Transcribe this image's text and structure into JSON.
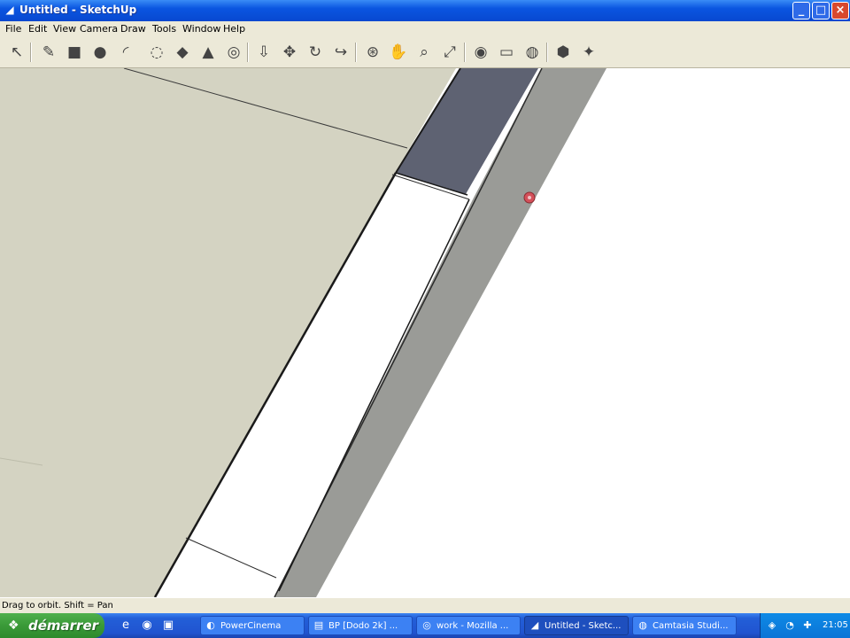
{
  "window": {
    "title": "Untitled - SketchUp",
    "app_icon": "sketchup-icon",
    "controls": {
      "minimize": "_",
      "maximize": "□",
      "close": "×"
    }
  },
  "menu": [
    "File",
    "Edit",
    "View",
    "Camera",
    "Draw",
    "Tools",
    "Window",
    "Help"
  ],
  "toolbar": {
    "tools": [
      {
        "name": "select-arrow-icon",
        "glyph": "↖"
      },
      {
        "name": "pencil-line-icon",
        "glyph": "✎"
      },
      {
        "name": "rectangle-icon",
        "glyph": "■"
      },
      {
        "name": "circle-icon",
        "glyph": "●"
      },
      {
        "name": "arc-icon",
        "glyph": "◜"
      },
      {
        "name": "offset-icon",
        "glyph": "◌"
      },
      {
        "name": "eraser-icon",
        "glyph": "◆"
      },
      {
        "name": "tape-measure-icon",
        "glyph": "▲"
      },
      {
        "name": "paint-bucket-icon",
        "glyph": "◎"
      },
      {
        "name": "push-pull-icon",
        "glyph": "⇩"
      },
      {
        "name": "move-icon",
        "glyph": "✥"
      },
      {
        "name": "rotate-icon",
        "glyph": "↻"
      },
      {
        "name": "follow-me-icon",
        "glyph": "↪"
      },
      {
        "name": "orbit-icon",
        "glyph": "⊛"
      },
      {
        "name": "pan-icon",
        "glyph": "✋"
      },
      {
        "name": "zoom-icon",
        "glyph": "⌕"
      },
      {
        "name": "zoom-extents-icon",
        "glyph": "⤢"
      },
      {
        "name": "get-models-icon",
        "glyph": "◉"
      },
      {
        "name": "share-model-icon",
        "glyph": "▭"
      },
      {
        "name": "component-icon",
        "glyph": "◍"
      },
      {
        "name": "warehouse-icon",
        "glyph": "⬢"
      },
      {
        "name": "extension-icon",
        "glyph": "✦"
      }
    ]
  },
  "status": {
    "text": "Drag to orbit.  Shift = Pan"
  },
  "taskbar": {
    "start_label": "démarrer",
    "quick_launch": [
      {
        "name": "ie-quicklaunch-icon",
        "glyph": "e"
      },
      {
        "name": "media-quicklaunch-icon",
        "glyph": "◉"
      },
      {
        "name": "desktop-quicklaunch-icon",
        "glyph": "▣"
      }
    ],
    "tasks": [
      {
        "name": "task-powercinema",
        "label": "PowerCinema",
        "glyph": "◐",
        "active": false
      },
      {
        "name": "task-bp-desktop",
        "label": "BP [Dodo 2k] ...",
        "glyph": "▤",
        "active": false
      },
      {
        "name": "task-mozilla",
        "label": "work - Mozilla ...",
        "glyph": "◎",
        "active": false
      },
      {
        "name": "task-sketchup",
        "label": "Untitled - Sketc...",
        "glyph": "◢",
        "active": true
      },
      {
        "name": "task-camtasia",
        "label": "Camtasia Studi...",
        "glyph": "◍",
        "active": false
      }
    ],
    "tray_icons": [
      {
        "name": "network-tray-icon",
        "glyph": "◈"
      },
      {
        "name": "volume-tray-icon",
        "glyph": "◔"
      },
      {
        "name": "security-tray-icon",
        "glyph": "✚"
      }
    ],
    "clock": "21:05"
  },
  "colors": {
    "ground": "#d4d3c2",
    "dark_face": "#5e6272",
    "gray_strip": "#9a9b97",
    "edge": "#1a1a1a"
  }
}
